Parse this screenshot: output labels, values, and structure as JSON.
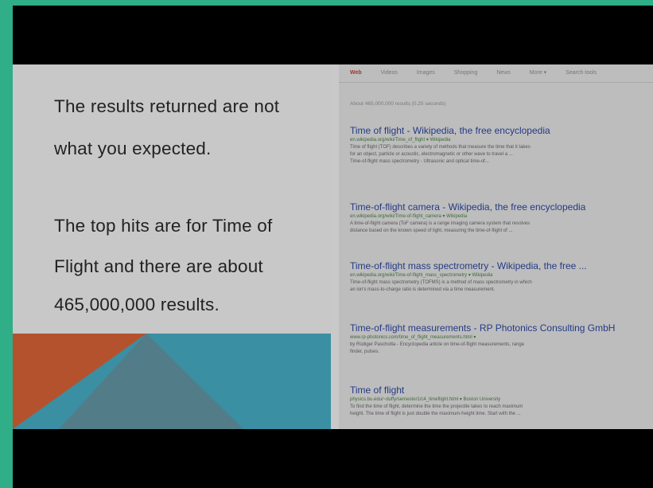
{
  "slide": {
    "paragraph1": {
      "line1": "The results returned are not",
      "line2": "what you expected."
    },
    "paragraph2": {
      "line1": "The top hits are for Time of",
      "line2": "Flight and there are about",
      "line3": "465,000,000 results."
    }
  },
  "search": {
    "tabs": [
      "Web",
      "Videos",
      "Images",
      "Shopping",
      "News",
      "More ▾",
      "Search tools"
    ],
    "active_tab": "Web",
    "stats": "About 465,000,000 results (0.25 seconds)",
    "results": [
      {
        "title": "Time of flight - Wikipedia, the free encyclopedia",
        "url": "en.wikipedia.org/wiki/Time_of_flight ▾  Wikipedia",
        "snippet1": "Time of flight (TOF) describes a variety of methods that measure the time that it takes",
        "snippet2": "for an object, particle or acoustic, electromagnetic or other wave to travel a ...",
        "snippet3": "Time-of-flight mass spectrometry - Ultrasonic and optical time-of..."
      },
      {
        "title": "Time-of-flight camera - Wikipedia, the free encyclopedia",
        "url": "en.wikipedia.org/wiki/Time-of-flight_camera ▾  Wikipedia",
        "snippet1": "A time-of-flight camera (ToF camera) is a range imaging camera system that resolves",
        "snippet2": "distance based on the known speed of light, measuring the time-of-flight of ..."
      },
      {
        "title": "Time-of-flight mass spectrometry - Wikipedia, the free ...",
        "url": "en.wikipedia.org/wiki/Time-of-flight_mass_spectrometry ▾  Wikipedia",
        "snippet1": "Time-of-flight mass spectrometry (TOFMS) is a method of mass spectrometry in which",
        "snippet2": "an ion's mass-to-charge ratio is determined via a time measurement."
      },
      {
        "title": "Time-of-flight measurements - RP Photonics Consulting GmbH",
        "url": "www.rp-photonics.com/time_of_flight_measurements.html ▾",
        "snippet1": "by Rüdiger Paschotta - Encyclopedia article on time-of-flight measurements, range",
        "snippet2": "finder, pulses."
      },
      {
        "title": "Time of flight",
        "url": "physics.bu.edu/~duffy/semester1/c4_timeflight.html ▾  Boston University",
        "snippet1": "To find the time of flight, determine the time the projectile takes to reach maximum",
        "snippet2": "height. The time of flight is just double the maximum-height time. Start with the ..."
      }
    ]
  },
  "colors": {
    "page_border": "#2fae88",
    "letterbox": "#000000",
    "slide_bg": "#c8c8c8",
    "shape_orange": "#b4522e",
    "shape_teal": "#3a8fa3",
    "shape_slate": "#527c87",
    "link_title": "#253a86",
    "link_url": "#3f6a38"
  }
}
